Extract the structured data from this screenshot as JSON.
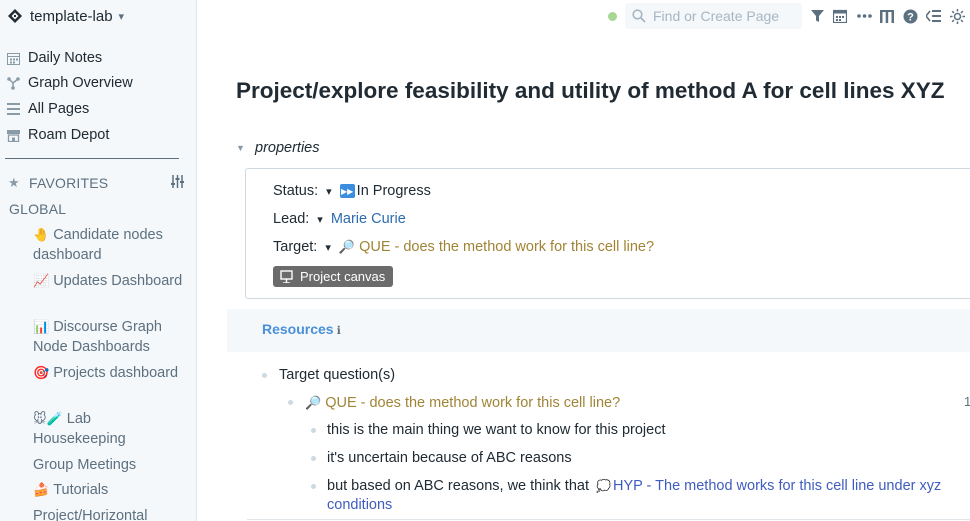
{
  "sidebar": {
    "graph_name": "template-lab",
    "nav": [
      {
        "label": "Daily Notes",
        "icon": "calendar-icon"
      },
      {
        "label": "Graph Overview",
        "icon": "graph-icon"
      },
      {
        "label": "All Pages",
        "icon": "list-icon"
      },
      {
        "label": "Roam Depot",
        "icon": "store-icon"
      }
    ],
    "favorites_label": "FAVORITES",
    "global_label": "GLOBAL",
    "links": [
      {
        "emoji": "🤚",
        "label": "Candidate nodes dashboard"
      },
      {
        "emoji": "📈",
        "label": "Updates Dashboard"
      },
      {
        "emoji": "📊",
        "label": "Discourse Graph Node Dashboards"
      },
      {
        "emoji": "🎯",
        "label": "Projects dashboard"
      },
      {
        "emoji": "🐭🧪",
        "label": "Lab Housekeeping"
      },
      {
        "emoji": "",
        "label": "Group Meetings"
      },
      {
        "emoji": "🍰",
        "label": "Tutorials"
      },
      {
        "emoji": "",
        "label": "Project/Horizontal"
      }
    ]
  },
  "topbar": {
    "search_placeholder": "Find or Create Page"
  },
  "page": {
    "title": "Project/explore feasibility and utility of method A for cell lines XYZ",
    "properties_label": "properties",
    "status_key": "Status:",
    "status_value": "In Progress",
    "lead_key": "Lead:",
    "lead_value": "Marie Curie",
    "target_key": "Target:",
    "target_value": "QUE - does the method work for this cell line?",
    "canvas_button": "Project canvas",
    "resources_label": "Resources",
    "blocks": {
      "target_questions": "Target question(s)",
      "que": "QUE - does the method work for this cell line?",
      "child1": "this is the main thing we want to know for this project",
      "child2": "it's uncertain because of ABC reasons",
      "child3_prefix": "but based on ABC reasons, we think that",
      "child3_hyp_a": "HYP - The method works for this cell line under xyz",
      "child3_hyp_b": "conditions"
    },
    "edge_count": "1"
  },
  "colors": {
    "sidebar_bg": "#f5f8fa",
    "que_color": "#a08436",
    "hyp_color": "#3f5cc0",
    "link_color": "#2b6cb0",
    "resources_color": "#4a90d9",
    "status_icon": "#3b8de0",
    "sync_dot": "#a7d793"
  }
}
